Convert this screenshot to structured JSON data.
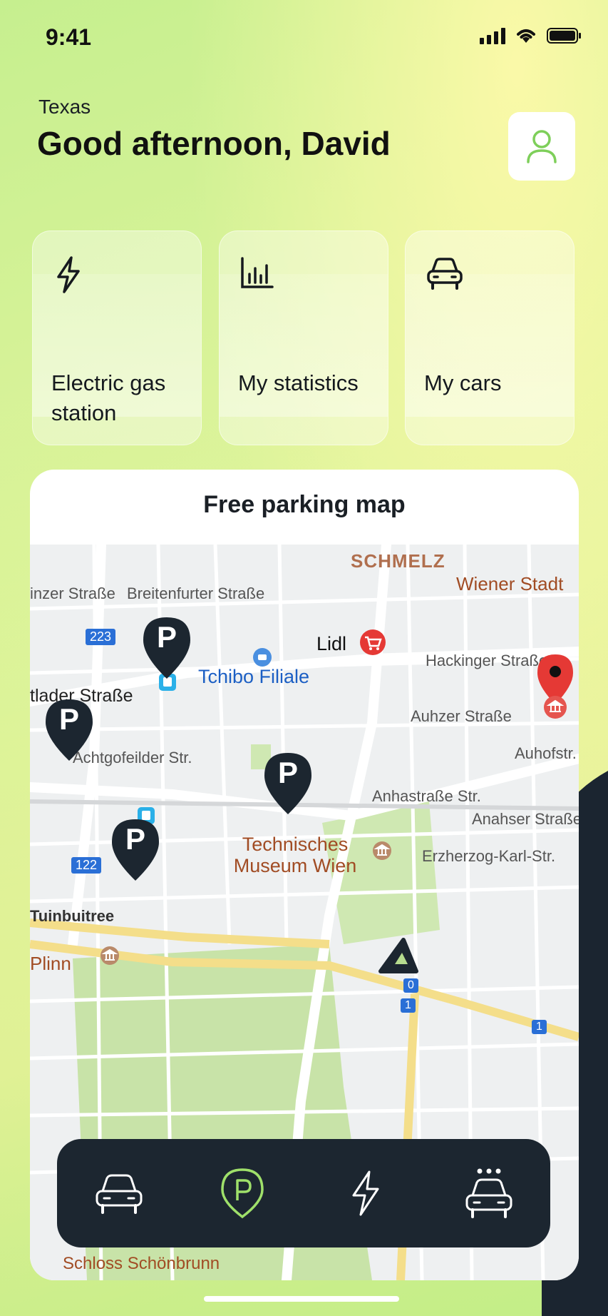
{
  "status_bar": {
    "time": "9:41",
    "icons": [
      "signal-icon",
      "wifi-icon",
      "battery-icon"
    ]
  },
  "header": {
    "location": "Texas",
    "greeting": "Good afternoon, David",
    "profile_icon": "user-icon"
  },
  "quick_actions": [
    {
      "icon": "bolt-icon",
      "label": "Electric gas station"
    },
    {
      "icon": "bar-chart-icon",
      "label": "My statistics"
    },
    {
      "icon": "car-icon",
      "label": "My cars"
    }
  ],
  "map": {
    "title": "Free parking map",
    "labels": {
      "schmelz": "SCHMELZ",
      "wiener": "Wiener Stadt",
      "inzer": "inzer Straße",
      "breitenfurter": "Breitenfurter Straße",
      "lidl": "Lidl",
      "tchibo": "Tchibo Filiale",
      "hackinger": "Hackinger Straße",
      "tlader": "tlader Straße",
      "auhzer": "Auhzer Straße",
      "achtgofelder": "Achtgofeilder Str.",
      "auhofstr": "Auhofstr.",
      "anhastrasse": "Anhastraße Str.",
      "anahser": "Anahser Straße",
      "technisches": "Technisches Museum Wien",
      "erzherzog": "Erzherzog-Karl-Str.",
      "tuinbuitree": "Tuinbuitree",
      "schloss": "Schloss Schönbrunn",
      "plinn": "Plinn",
      "sign_223": "223",
      "sign_122": "122",
      "sign_1a": "1",
      "sign_1b": "1",
      "sign_0": "0"
    },
    "parking_marker": "P"
  },
  "bottom_nav": [
    {
      "icon": "car-icon",
      "active": false
    },
    {
      "icon": "parking-pin-icon",
      "active": true
    },
    {
      "icon": "bolt-icon",
      "active": false
    },
    {
      "icon": "taxi-icon",
      "active": false
    }
  ],
  "colors": {
    "accent": "#9fe06a",
    "dark": "#1c2630",
    "pin": "#1c2630",
    "red_pin": "#e53935"
  }
}
